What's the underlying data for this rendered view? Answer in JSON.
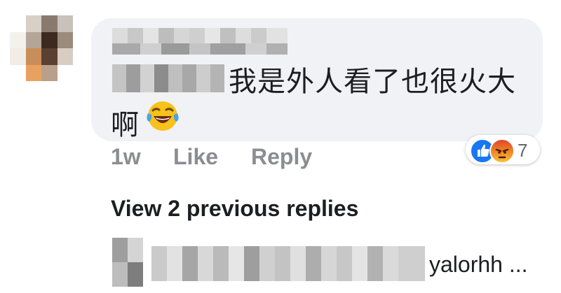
{
  "comment": {
    "text_line1": "我是外人看了也很火大",
    "text_line2": "啊",
    "emoji": "face-with-tears-of-joy",
    "time": "1w",
    "like_label": "Like",
    "reply_label": "Reply",
    "reaction_count": "7",
    "reactions": [
      "like",
      "angry"
    ]
  },
  "replies": {
    "view_previous_label": "View 2 previous replies",
    "preview_text": "yalorhh ..."
  },
  "colors": {
    "bubble": "#f0f2f5",
    "meta_text": "#8a8d91",
    "like_blue": "#1877f2"
  }
}
